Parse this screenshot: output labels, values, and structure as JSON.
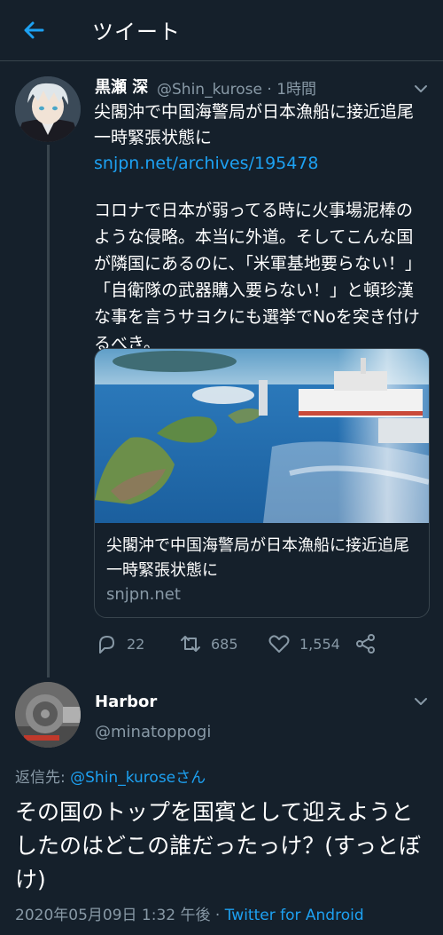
{
  "header": {
    "title": "ツイート"
  },
  "tweet1": {
    "name": "黒瀬 深",
    "handle": "@Shin_kurose · 1時間",
    "text": "尖閣沖で中国海警局が日本漁船に接近追尾　一時緊張状態に ",
    "link": "snjpn.net/archives/195478",
    "body": "コロナで日本が弱ってる時に火事場泥棒のような侵略。本当に外道。そしてこんな国が隣国にあるのに、「米軍基地要らない！」「自衛隊の武器購入要らない！」と頓珍漢な事を言うサヨクにも選挙でNoを突き付けるべき。",
    "card": {
      "title": "尖閣沖で中国海警局が日本漁船に接近追尾　一時緊張状態に",
      "domain": "snjpn.net"
    },
    "replies": "22",
    "retweets": "685",
    "likes": "1,554"
  },
  "tweet2": {
    "name": "Harbor",
    "handle": "@minatoppogi",
    "replying_label": "返信先: ",
    "replying_to": "@Shin_kuroseさん",
    "text": "その国のトップを国賓として迎えようとしたのはどこの誰だったっけ？(すっとぼけ)",
    "date": "2020年05月09日 1:32 午後 · ",
    "source": "Twitter for Android"
  },
  "colors": {
    "background": "#15202b",
    "accent": "#1da1f2",
    "muted": "#8899a6",
    "border": "#38444d"
  },
  "icons": [
    "back-arrow-icon",
    "chevron-down-icon",
    "reply-icon",
    "retweet-icon",
    "like-icon",
    "share-icon"
  ]
}
